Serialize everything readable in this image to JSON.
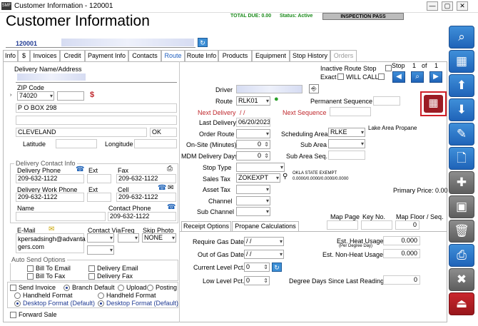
{
  "window": {
    "title": "Customer Information - 120001",
    "app_icon_label": "SMF",
    "min": "—",
    "max": "▢",
    "close": "✕"
  },
  "header": {
    "title": "Customer Information",
    "total_due": "TOTAL DUE:  0.00",
    "status": "Status: Active",
    "badge": "INSPECTION PASS",
    "customer_id": "120001"
  },
  "tabs": [
    {
      "label": "Info"
    },
    {
      "label": "$"
    },
    {
      "label": "Invoices"
    },
    {
      "label": "Credit"
    },
    {
      "label": "Payment Info"
    },
    {
      "label": "Contacts"
    },
    {
      "label": "Route",
      "active": true
    },
    {
      "label": "Route Info"
    },
    {
      "label": "Products"
    },
    {
      "label": "Equipment"
    },
    {
      "label": "Stop History"
    },
    {
      "label": "Orders",
      "disabled": true
    }
  ],
  "address": {
    "name_label": "Delivery Name/Address",
    "zip_label": "ZIP Code",
    "zip": "74020",
    "line1": "P O BOX 298",
    "city": "CLEVELAND",
    "state": "OK",
    "latitude_label": "Latitude",
    "longitude_label": "Longitude"
  },
  "contact": {
    "group_title": "Delivery Contact Info",
    "delivery_phone_label": "Delivery Phone",
    "delivery_phone": "209-632-1122",
    "ext_label": "Ext",
    "fax_label": "Fax",
    "fax": "209-632-1122",
    "work_phone_label": "Delivery Work Phone",
    "work_phone": "209-632-1122",
    "ext2_label": "Ext",
    "cell_label": "Cell",
    "cell": "209-632-1122",
    "name_label": "Name",
    "contact_phone_label": "Contact Phone",
    "contact_phone": "209-632-1122"
  },
  "email": {
    "label": "E-Mail",
    "value_line1": "kpersadsingh@advanta",
    "value_line2": "gers.com",
    "contact_via_label": "Contact Via",
    "freq_label": "Freq",
    "skip_photo_label": "Skip Photo",
    "skip_photo": "NONE"
  },
  "auto_send": {
    "title": "Auto Send Options",
    "bill_to_email": "Bill To Email",
    "delivery_email": "Delivery Email",
    "bill_to_fax": "Bill To Fax",
    "delivery_fax": "Delivery Fax",
    "send_invoice": "Send Invoice",
    "branch_default": "Branch Default",
    "upload": "Upload",
    "posting": "Posting",
    "handheld_format_1": "Handheld Format",
    "handheld_format_2": "Handheld Format",
    "desktop_format_1": "Desktop Format (Default)",
    "desktop_format_2": "Desktop Format (Default)",
    "forward_sale": "Forward Sale"
  },
  "route": {
    "inactive_route_stop": "Inactive Route Stop",
    "exact": "Exact",
    "will_call": "WILL CALL",
    "stop_label": "Stop",
    "stop_num": "1",
    "of_label": "of",
    "stop_total": "1",
    "driver_label": "Driver",
    "route_label": "Route",
    "route": "RLK01",
    "permanent_sequence_label": "Permanent Sequence",
    "next_delivery_label": "Next Delivery",
    "next_delivery": " / /",
    "next_sequence_label": "Next Sequence",
    "last_delivery_label": "Last Delivery",
    "last_delivery": "06/20/2023",
    "order_route_label": "Order Route",
    "scheduling_area_label": "Scheduling Area",
    "scheduling_area": "RLKE",
    "scheduling_area_desc": "Lake Area Propane",
    "onsite_label": "On-Site (Minutes)",
    "onsite": "0",
    "sub_area_label": "Sub Area",
    "mdm_label": "MDM Delivery Days",
    "mdm": "0",
    "sub_area_seq_label": "Sub Area Seq.",
    "stop_type_label": "Stop Type",
    "sales_tax_label": "Sales Tax",
    "sales_tax": "ZOKEXPT",
    "tax_desc_1": "OKLA STATE EXEMPT",
    "tax_desc_2": "0.0000/0.0000/0.0000/0.0000",
    "asset_tax_label": "Asset Tax",
    "primary_price": "Primary Price: 0.00",
    "channel_label": "Channel",
    "sub_channel_label": "Sub Channel",
    "map_page_label": "Map Page",
    "key_no_label": "Key No.",
    "map_floor_label": "Map Floor / Seq.",
    "map_floor": "0"
  },
  "subtabs": [
    {
      "label": "Receipt Options"
    },
    {
      "label": "Propane Calculations",
      "active": true
    }
  ],
  "propane": {
    "require_gas_label": "Require Gas Date",
    "require_gas": " / /",
    "est_heat_label": "Est. Heat Usage",
    "est_heat_sub": "(Per Degree Day)",
    "est_heat": "0.000",
    "out_gas_label": "Out of Gas Date",
    "out_gas": " / /",
    "est_nonheat_label": "Est. Non-Heat Usage",
    "est_nonheat": "0.000",
    "current_level_label": "Current Level Pct.",
    "current_level": "0",
    "low_level_label": "Low Level Pct.",
    "low_level": "0",
    "degree_days_label": "Degree Days Since Last Reading",
    "degree_days": "0"
  },
  "colors": {
    "accent_blue": "#1f63b8",
    "red": "#c0282d",
    "green": "#1a8a1a"
  }
}
